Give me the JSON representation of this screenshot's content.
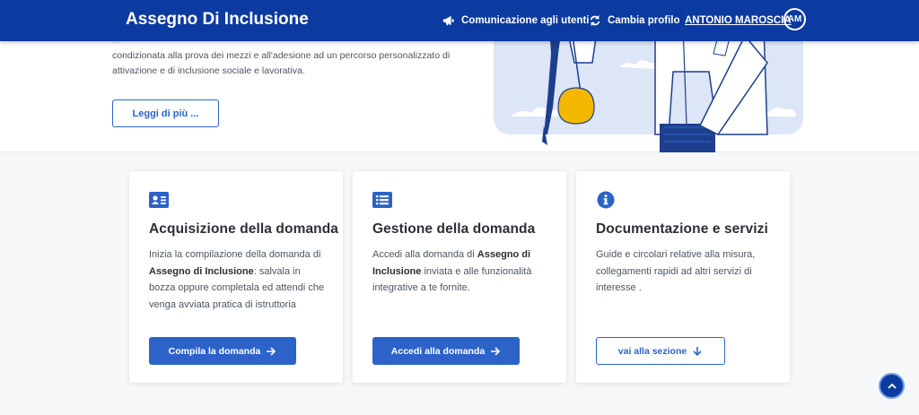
{
  "header": {
    "brand": "Assegno Di Inclusione",
    "communications": "Comunicazione agli utenti",
    "change_profile": "Cambia profilo",
    "user_name": "ANTONIO MAROSCIA",
    "avatar_initials": "AM",
    "bg_color": "#0b3aa0"
  },
  "hero": {
    "text_line1": "…",
    "text_line2": "condizionata alla prova dei mezzi e all'adesione ad un percorso personalizzato di",
    "text_line3": "attivazione e di inclusione sociale e lavorativa.",
    "more_button": "Leggi di più ..."
  },
  "cards": [
    {
      "icon": "id-card-icon",
      "title": "Acquisizione della domanda",
      "desc_a": "Inizia la compilazione della domanda di ",
      "desc_b": "Assegno di Inclusione",
      "desc_c": ": salvala in bozza oppure completala ed attendi che venga avviata pratica di istruttoria",
      "button": "Compila la domanda"
    },
    {
      "icon": "list-icon",
      "title": "Gestione della domanda",
      "desc_a": "Accedi alla domanda di ",
      "desc_b": "Assegno di Inclusione",
      "desc_c": " inviata e alle funzionalità integrative a te fornite.",
      "button": "Accedi alla domanda"
    },
    {
      "icon": "info-icon",
      "title": "Documentazione e servizi",
      "desc_a": "Guide e circolari relative alla misura, collegamenti rapidi ad altri servizi di interesse .",
      "button": "vai alla sezione"
    }
  ],
  "colors": {
    "primary": "#2d63c8",
    "header": "#0b3aa0"
  }
}
